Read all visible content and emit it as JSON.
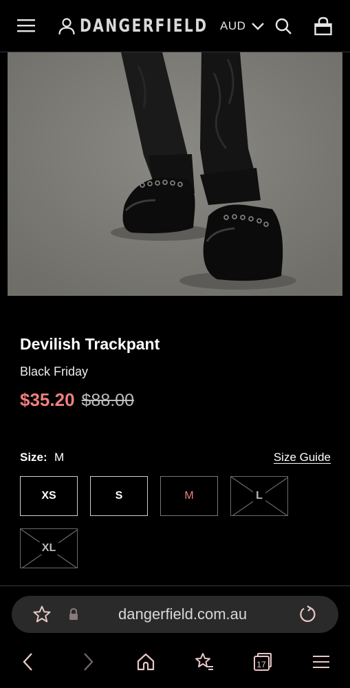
{
  "header": {
    "logo": "DANGERFIELD",
    "currency": "AUD",
    "icons": {
      "menu": "hamburger-icon",
      "account": "user-icon",
      "currency_toggle": "chevron-down-icon",
      "search": "search-icon",
      "bag": "shopping-bag-icon"
    }
  },
  "product": {
    "title": "Devilish Trackpant",
    "collection": "Black Friday",
    "price_sale": "$35.20",
    "price_original": "$88.00",
    "sale_color": "#ef7f7f"
  },
  "size": {
    "label": "Size:",
    "selected": "M",
    "guide_label": "Size Guide",
    "options": [
      {
        "label": "XS",
        "state": "available"
      },
      {
        "label": "S",
        "state": "available"
      },
      {
        "label": "M",
        "state": "selected"
      },
      {
        "label": "L",
        "state": "unavailable"
      },
      {
        "label": "XL",
        "state": "unavailable"
      }
    ]
  },
  "browser": {
    "url": "dangerfield.com.au",
    "tab_count": "17",
    "accent": "#e9c8c8",
    "icons": {
      "bookmark": "star-icon",
      "lock": "lock-icon",
      "reload": "reload-icon",
      "back": "chevron-left-icon",
      "forward": "chevron-right-icon",
      "home": "home-icon",
      "bookmarks": "star-list-icon",
      "tabs": "tabs-icon",
      "menu": "hamburger-icon"
    }
  }
}
